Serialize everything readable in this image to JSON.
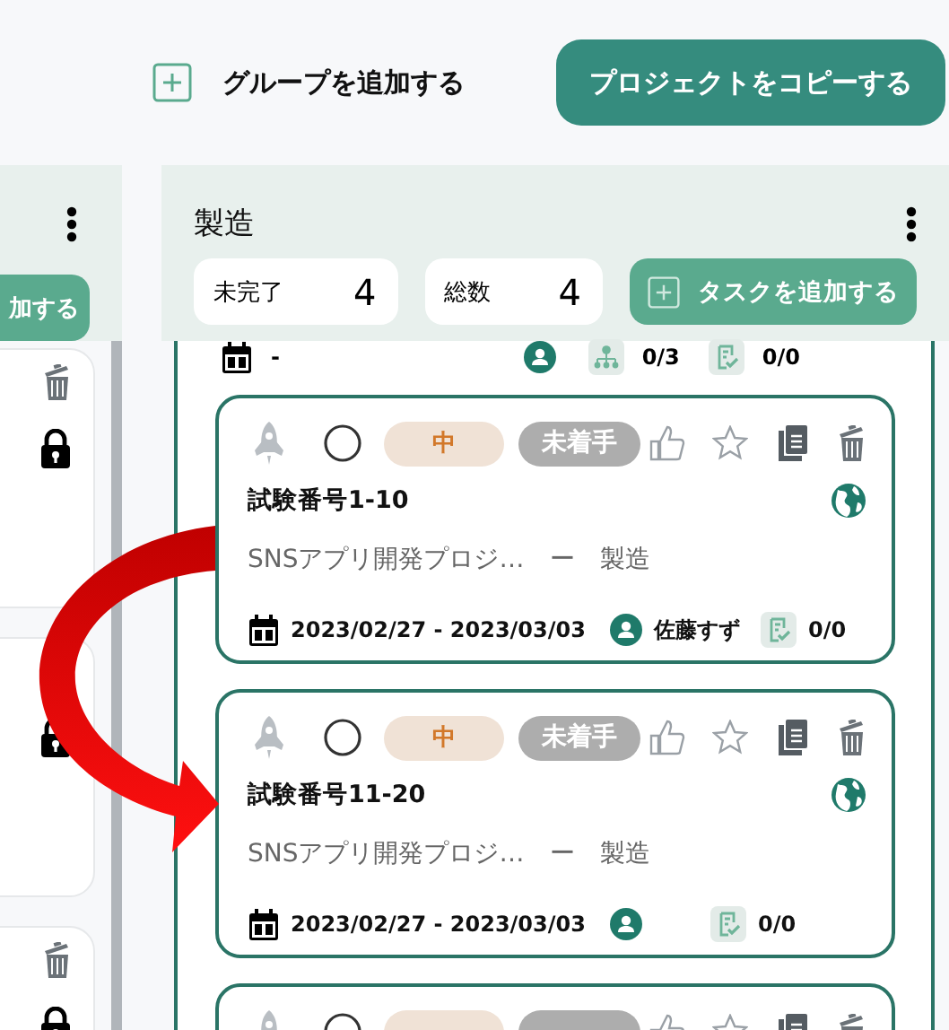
{
  "toolbar": {
    "add_group": "グループを追加する",
    "copy_project": "プロジェクトをコピーする"
  },
  "left_column": {
    "add_task": "加する",
    "cards": [
      {
        "locked": true
      },
      {
        "locked": true
      },
      {
        "locked": true
      }
    ]
  },
  "column": {
    "title": "製造",
    "stats": [
      {
        "label": "未完了",
        "value": "4"
      },
      {
        "label": "総数",
        "value": "4"
      }
    ],
    "add_task": "タスクを追加する",
    "partial_card": {
      "date": "-",
      "subtasks": "0/3",
      "checks": "0/0"
    },
    "cards": [
      {
        "priority": "中",
        "status": "未着手",
        "done": false,
        "liked": false,
        "starred": false,
        "title": "試験番号1-10",
        "project": "SNSアプリ開発プロジ…",
        "separator": "ー",
        "group": "製造",
        "date": "2023/02/27 - 2023/03/03",
        "assignee": "佐藤すず",
        "checks": "0/0"
      },
      {
        "priority": "中",
        "status": "未着手",
        "done": false,
        "liked": false,
        "starred": false,
        "title": "試験番号11-20",
        "project": "SNSアプリ開発プロジ…",
        "separator": "ー",
        "group": "製造",
        "date": "2023/02/27 - 2023/03/03",
        "checks": "0/0"
      },
      {
        "done": false,
        "liked": false,
        "starred": false
      }
    ]
  }
}
